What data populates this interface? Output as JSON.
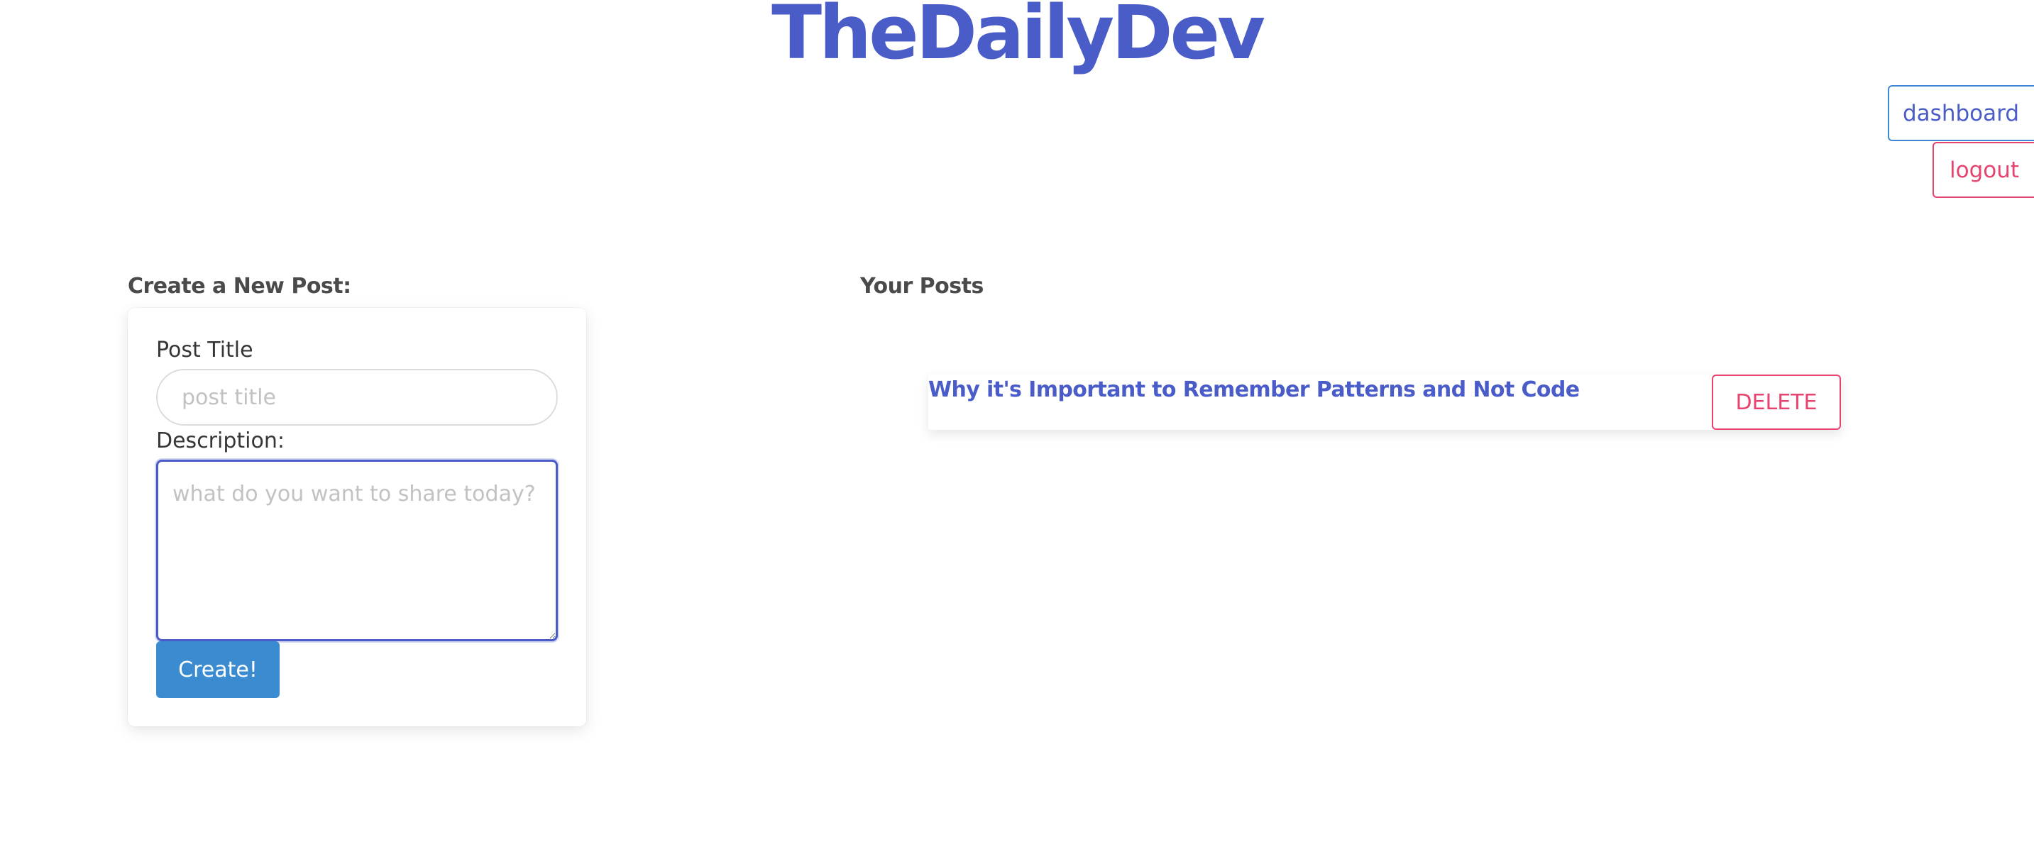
{
  "header": {
    "site_title": "TheDailyDev"
  },
  "nav": {
    "dashboard_label": "dashboard",
    "logout_label": "logout"
  },
  "create_section": {
    "heading": "Create a New Post:",
    "title_label": "Post Title",
    "title_value": "",
    "title_placeholder": "post title",
    "description_label": "Description:",
    "description_value": "",
    "description_placeholder": "what do you want to share today?",
    "create_button_label": "Create!"
  },
  "posts_section": {
    "heading": "Your Posts",
    "posts": [
      {
        "title": "Why it's Important to Remember Patterns and Not Code",
        "delete_label": "DELETE"
      }
    ]
  },
  "colors": {
    "brand": "#4a5cc7",
    "primary_button": "#3a8bd0",
    "danger": "#e7436f",
    "heading_text": "#4a4a4a"
  }
}
